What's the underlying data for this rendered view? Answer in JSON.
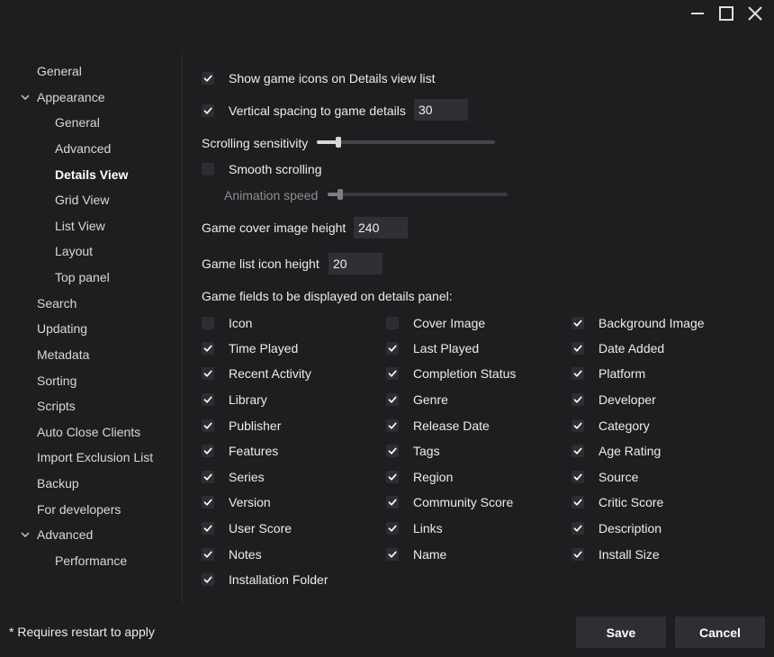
{
  "window": {
    "controls": [
      "minimize-icon",
      "maximize-icon",
      "close-icon"
    ]
  },
  "sidebar": {
    "items": [
      {
        "label": "General",
        "level": 0
      },
      {
        "label": "Appearance",
        "level": 0,
        "expanded": true
      },
      {
        "label": "General",
        "level": 1
      },
      {
        "label": "Advanced",
        "level": 1
      },
      {
        "label": "Details View",
        "level": 1,
        "active": true
      },
      {
        "label": "Grid View",
        "level": 1
      },
      {
        "label": "List View",
        "level": 1
      },
      {
        "label": "Layout",
        "level": 1
      },
      {
        "label": "Top panel",
        "level": 1
      },
      {
        "label": "Search",
        "level": 0
      },
      {
        "label": "Updating",
        "level": 0
      },
      {
        "label": "Metadata",
        "level": 0
      },
      {
        "label": "Sorting",
        "level": 0
      },
      {
        "label": "Scripts",
        "level": 0
      },
      {
        "label": "Auto Close Clients",
        "level": 0
      },
      {
        "label": "Import Exclusion List",
        "level": 0
      },
      {
        "label": "Backup",
        "level": 0
      },
      {
        "label": "For developers",
        "level": 0
      },
      {
        "label": "Advanced",
        "level": 0,
        "expanded": true
      },
      {
        "label": "Performance",
        "level": 1
      }
    ]
  },
  "settings": {
    "show_icons": {
      "label": "Show game icons on Details view list",
      "checked": true
    },
    "vertical_spacing": {
      "label": "Vertical spacing to game details",
      "checked": true,
      "value": "30"
    },
    "scrolling_sensitivity": {
      "label": "Scrolling sensitivity",
      "level": 0.12
    },
    "smooth_scrolling": {
      "label": "Smooth scrolling",
      "checked": false
    },
    "animation_speed": {
      "label": "Animation speed",
      "level": 0.07,
      "disabled": true
    },
    "cover_height": {
      "label": "Game cover image height",
      "value": "240"
    },
    "icon_height": {
      "label": "Game list icon height",
      "value": "20"
    },
    "fields_heading": "Game fields to be displayed on details panel:"
  },
  "fields": {
    "col1": [
      {
        "label": "Icon",
        "checked": false
      },
      {
        "label": "Time Played",
        "checked": true
      },
      {
        "label": "Recent Activity",
        "checked": true
      },
      {
        "label": "Library",
        "checked": true
      },
      {
        "label": "Publisher",
        "checked": true
      },
      {
        "label": "Features",
        "checked": true
      },
      {
        "label": "Series",
        "checked": true
      },
      {
        "label": "Version",
        "checked": true
      },
      {
        "label": "User Score",
        "checked": true
      },
      {
        "label": "Notes",
        "checked": true
      },
      {
        "label": "Installation Folder",
        "checked": true
      }
    ],
    "col2": [
      {
        "label": "Cover Image",
        "checked": false
      },
      {
        "label": "Last Played",
        "checked": true
      },
      {
        "label": "Completion Status",
        "checked": true
      },
      {
        "label": "Genre",
        "checked": true
      },
      {
        "label": "Release Date",
        "checked": true
      },
      {
        "label": "Tags",
        "checked": true
      },
      {
        "label": "Region",
        "checked": true
      },
      {
        "label": "Community Score",
        "checked": true
      },
      {
        "label": "Links",
        "checked": true
      },
      {
        "label": "Name",
        "checked": true
      }
    ],
    "col3": [
      {
        "label": "Background Image",
        "checked": true
      },
      {
        "label": "Date Added",
        "checked": true
      },
      {
        "label": "Platform",
        "checked": true
      },
      {
        "label": "Developer",
        "checked": true
      },
      {
        "label": "Category",
        "checked": true
      },
      {
        "label": "Age Rating",
        "checked": true
      },
      {
        "label": "Source",
        "checked": true
      },
      {
        "label": "Critic Score",
        "checked": true
      },
      {
        "label": "Description",
        "checked": true
      },
      {
        "label": "Install Size",
        "checked": true
      }
    ]
  },
  "footer": {
    "note": "* Requires restart to apply",
    "save_label": "Save",
    "cancel_label": "Cancel"
  },
  "colors": {
    "background": "#1d1e20",
    "check": "#ffffff",
    "checkbox_bg": "#2d2e31",
    "button_bg": "#2e2f33"
  }
}
